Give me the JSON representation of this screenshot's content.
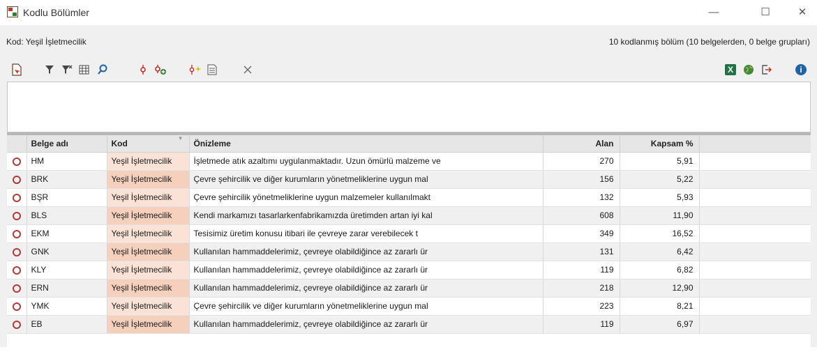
{
  "window": {
    "title": "Kodlu Bölümler",
    "minimize_glyph": "—",
    "maximize_glyph": "☐",
    "close_glyph": "✕"
  },
  "header": {
    "code_label": "Kod: Yeşil İşletmecilik",
    "summary": "10 kodlanmış bölüm (10 belgelerden, 0 belge grupları)"
  },
  "toolbar": {
    "icons": [
      "document-pointer-icon",
      "filter-icon",
      "clear-filter-icon",
      "column-grid-icon",
      "search-icon",
      "code-icon",
      "add-code-icon",
      "code-highlight-icon",
      "overview-list-icon",
      "close-icon",
      "excel-export-icon",
      "globe-icon",
      "export-icon",
      "info-icon"
    ]
  },
  "table": {
    "columns": [
      "",
      "Belge adı",
      "Kod",
      "Önizleme",
      "Alan",
      "Kapsam %",
      ""
    ],
    "rows": [
      {
        "doc": "HM",
        "code": "Yeşil İşletmecilik",
        "preview": "İşletmede atık azaltımı uygulanmaktadır. Uzun ömürlü malzeme ve",
        "area": "270",
        "coverage": "5,91"
      },
      {
        "doc": "BRK",
        "code": "Yeşil İşletmecilik",
        "preview": "Çevre şehircilik ve diğer kurumların yönetmeliklerine uygun mal",
        "area": "156",
        "coverage": "5,22"
      },
      {
        "doc": "BŞR",
        "code": "Yeşil İşletmecilik",
        "preview": "Çevre şehircilik yönetmeliklerine uygun malzemeler kullanılmakt",
        "area": "132",
        "coverage": "5,93"
      },
      {
        "doc": "BLS",
        "code": "Yeşil İşletmecilik",
        "preview": "Kendi markamızı tasarlarkenfabrikamızda üretimden artan iyi kal",
        "area": "608",
        "coverage": "11,90"
      },
      {
        "doc": "EKM",
        "code": "Yeşil İşletmecilik",
        "preview": "Tesisimiz üretim konusu itibari ile çevreye zarar verebilecek t",
        "area": "349",
        "coverage": "16,52"
      },
      {
        "doc": "GNK",
        "code": "Yeşil İşletmecilik",
        "preview": "Kullanılan hammaddelerimiz, çevreye olabildiğince az zararlı ür",
        "area": "131",
        "coverage": "6,42"
      },
      {
        "doc": "KLY",
        "code": "Yeşil İşletmecilik",
        "preview": "Kullanılan hammaddelerimiz, çevreye olabildiğince az zararlı ür",
        "area": "119",
        "coverage": "6,82"
      },
      {
        "doc": "ERN",
        "code": "Yeşil İşletmecilik",
        "preview": "Kullanılan hammaddelerimiz, çevreye olabildiğince az zararlı ür",
        "area": "218",
        "coverage": "12,90"
      },
      {
        "doc": "YMK",
        "code": "Yeşil İşletmecilik",
        "preview": "Çevre şehircilik ve diğer kurumların yönetmeliklerine uygun mal",
        "area": "223",
        "coverage": "8,21"
      },
      {
        "doc": "EB",
        "code": "Yeşil İşletmecilik",
        "preview": "Kullanılan hammaddelerimiz, çevreye olabildiğince az zararlı ür",
        "area": "119",
        "coverage": "6,97"
      }
    ]
  },
  "colors": {
    "code_highlight": "#fbe2d6",
    "marker": "#b03a3a",
    "toolbar_accent": "#1f63a8"
  }
}
